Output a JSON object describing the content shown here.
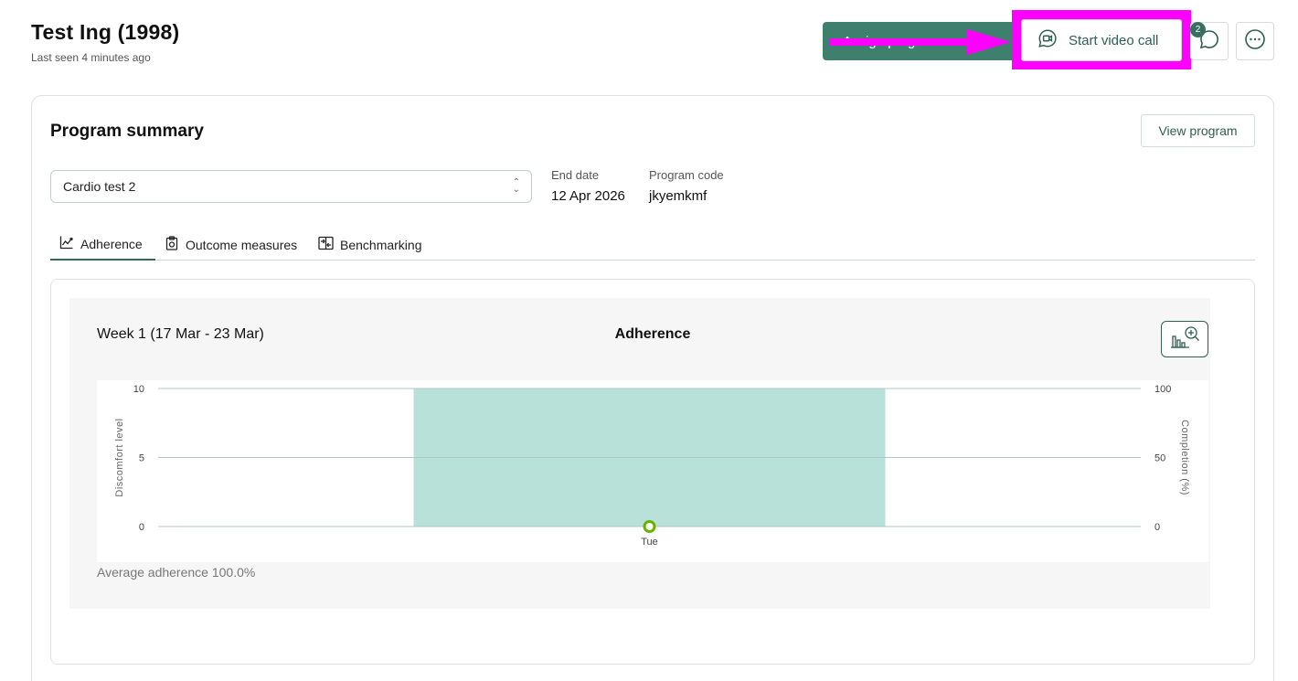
{
  "header": {
    "patient_name": "Test Ing (1998)",
    "last_seen": "Last seen 4 minutes ago",
    "assign_button_label": "Assign program",
    "video_call_label": "Start video call",
    "chat_badge_count": "2",
    "annotation_color": "#ff00ff",
    "brand_color": "#3f7f6e"
  },
  "program_summary": {
    "title": "Program summary",
    "view_program_label": "View program",
    "selected_program": "Cardio test 2",
    "end_date_label": "End date",
    "end_date_value": "12 Apr 2026",
    "program_code_label": "Program code",
    "program_code_value": "jkyemkmf"
  },
  "tabs": [
    {
      "label": "Adherence",
      "icon": "line-chart-icon",
      "active": true
    },
    {
      "label": "Outcome measures",
      "icon": "clipboard-icon",
      "active": false
    },
    {
      "label": "Benchmarking",
      "icon": "compare-icon",
      "active": false
    }
  ],
  "chart_panel": {
    "week_label": "Week 1 (17 Mar - 23 Mar)",
    "average_adherence": "Average adherence 100.0%"
  },
  "chart_data": {
    "type": "bar",
    "title": "Adherence",
    "categories": [
      "Tue"
    ],
    "series": [
      {
        "name": "Completion (%)",
        "axis": "right",
        "values": [
          100
        ],
        "color": "#b8e2d9"
      },
      {
        "name": "Discomfort level",
        "axis": "left",
        "values": [
          0
        ],
        "color": "#6ab000"
      }
    ],
    "ylabel_left": "Discomfort level",
    "ylabel_right": "Completion (%)",
    "ylim_left": [
      0,
      10
    ],
    "yticks_left": [
      0,
      5,
      10
    ],
    "ylim_right": [
      0,
      100
    ],
    "yticks_right": [
      0,
      50,
      100
    ],
    "grid": true
  }
}
